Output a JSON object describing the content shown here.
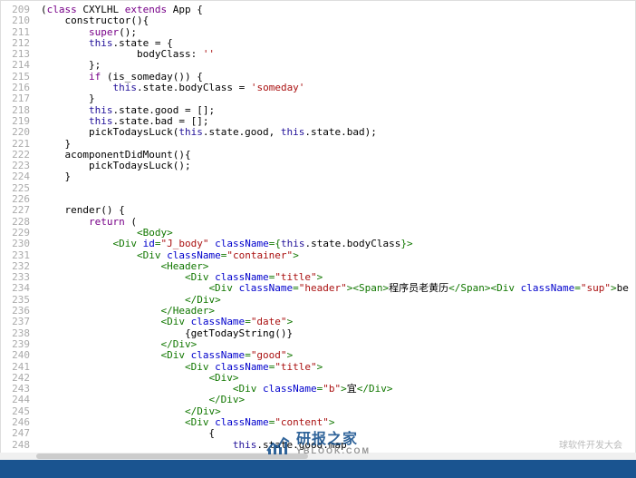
{
  "lines": [
    {
      "n": 209,
      "t": [
        [
          "",
          "("
        ],
        [
          "kw",
          "class"
        ],
        [
          "",
          " CXYLHL "
        ],
        [
          "kw",
          "extends"
        ],
        [
          "",
          " App {"
        ]
      ]
    },
    {
      "n": 210,
      "t": [
        [
          "",
          "    constructor(){"
        ]
      ]
    },
    {
      "n": 211,
      "t": [
        [
          "",
          "        "
        ],
        [
          "kw",
          "super"
        ],
        [
          "",
          "();"
        ]
      ]
    },
    {
      "n": 212,
      "t": [
        [
          "",
          "        "
        ],
        [
          "this",
          "this"
        ],
        [
          "",
          ".state = {"
        ]
      ]
    },
    {
      "n": 213,
      "t": [
        [
          "",
          "                bodyClass: "
        ],
        [
          "str",
          "''"
        ]
      ]
    },
    {
      "n": 214,
      "t": [
        [
          "",
          "        };"
        ]
      ]
    },
    {
      "n": 215,
      "t": [
        [
          "",
          "        "
        ],
        [
          "kw",
          "if"
        ],
        [
          "",
          " (is_someday()) {"
        ]
      ]
    },
    {
      "n": 216,
      "t": [
        [
          "",
          "            "
        ],
        [
          "this",
          "this"
        ],
        [
          "",
          ".state.bodyClass = "
        ],
        [
          "str",
          "'someday'"
        ]
      ]
    },
    {
      "n": 217,
      "t": [
        [
          "",
          "        }"
        ]
      ]
    },
    {
      "n": 218,
      "t": [
        [
          "",
          "        "
        ],
        [
          "this",
          "this"
        ],
        [
          "",
          ".state.good = [];"
        ]
      ]
    },
    {
      "n": 219,
      "t": [
        [
          "",
          "        "
        ],
        [
          "this",
          "this"
        ],
        [
          "",
          ".state.bad = [];"
        ]
      ]
    },
    {
      "n": 220,
      "t": [
        [
          "",
          "        pickTodaysLuck("
        ],
        [
          "this",
          "this"
        ],
        [
          "",
          ".state.good, "
        ],
        [
          "this",
          "this"
        ],
        [
          "",
          ".state.bad);"
        ]
      ]
    },
    {
      "n": 221,
      "t": [
        [
          "",
          "    }"
        ]
      ]
    },
    {
      "n": 222,
      "t": [
        [
          "",
          "    acomponentDidMount(){"
        ]
      ]
    },
    {
      "n": 223,
      "t": [
        [
          "",
          "        pickTodaysLuck();"
        ]
      ]
    },
    {
      "n": 224,
      "t": [
        [
          "",
          "    }"
        ]
      ]
    },
    {
      "n": 225,
      "t": [
        [
          "",
          ""
        ]
      ]
    },
    {
      "n": 226,
      "t": [
        [
          "",
          ""
        ]
      ]
    },
    {
      "n": 227,
      "t": [
        [
          "",
          "    render() {"
        ]
      ]
    },
    {
      "n": 228,
      "t": [
        [
          "",
          "        "
        ],
        [
          "kw",
          "return"
        ],
        [
          "",
          " ("
        ]
      ]
    },
    {
      "n": 229,
      "t": [
        [
          "",
          "                "
        ],
        [
          "tag",
          "<Body>"
        ]
      ]
    },
    {
      "n": 230,
      "t": [
        [
          "",
          "            "
        ],
        [
          "tag",
          "<Div "
        ],
        [
          "attr",
          "id"
        ],
        [
          "tag",
          "="
        ],
        [
          "str",
          "\"J_body\""
        ],
        [
          "tag",
          " "
        ],
        [
          "attr",
          "className"
        ],
        [
          "tag",
          "={"
        ],
        [
          "this",
          "this"
        ],
        [
          "",
          ".state.bodyClass"
        ],
        [
          "tag",
          "}>"
        ]
      ]
    },
    {
      "n": 231,
      "t": [
        [
          "",
          "                "
        ],
        [
          "tag",
          "<Div "
        ],
        [
          "attr",
          "className"
        ],
        [
          "tag",
          "="
        ],
        [
          "str",
          "\"container\""
        ],
        [
          "tag",
          ">"
        ]
      ]
    },
    {
      "n": 232,
      "t": [
        [
          "",
          "                    "
        ],
        [
          "tag",
          "<Header>"
        ]
      ]
    },
    {
      "n": 233,
      "t": [
        [
          "",
          "                        "
        ],
        [
          "tag",
          "<Div "
        ],
        [
          "attr",
          "className"
        ],
        [
          "tag",
          "="
        ],
        [
          "str",
          "\"title\""
        ],
        [
          "tag",
          ">"
        ]
      ]
    },
    {
      "n": 234,
      "t": [
        [
          "",
          "                            "
        ],
        [
          "tag",
          "<Div "
        ],
        [
          "attr",
          "className"
        ],
        [
          "tag",
          "="
        ],
        [
          "str",
          "\"header\""
        ],
        [
          "tag",
          "><Span>"
        ],
        [
          "",
          "程序员老黄历"
        ],
        [
          "tag",
          "</Span><Div "
        ],
        [
          "attr",
          "className"
        ],
        [
          "tag",
          "="
        ],
        [
          "str",
          "\"sup\""
        ],
        [
          "tag",
          ">"
        ],
        [
          "",
          "be"
        ]
      ]
    },
    {
      "n": 235,
      "t": [
        [
          "",
          "                        "
        ],
        [
          "tag",
          "</Div>"
        ]
      ]
    },
    {
      "n": 236,
      "t": [
        [
          "",
          "                    "
        ],
        [
          "tag",
          "</Header>"
        ]
      ]
    },
    {
      "n": 237,
      "t": [
        [
          "",
          "                    "
        ],
        [
          "tag",
          "<Div "
        ],
        [
          "attr",
          "className"
        ],
        [
          "tag",
          "="
        ],
        [
          "str",
          "\"date\""
        ],
        [
          "tag",
          ">"
        ]
      ]
    },
    {
      "n": 238,
      "t": [
        [
          "",
          "                        {getTodayString()}"
        ]
      ]
    },
    {
      "n": 239,
      "t": [
        [
          "",
          "                    "
        ],
        [
          "tag",
          "</Div>"
        ]
      ]
    },
    {
      "n": 240,
      "t": [
        [
          "",
          "                    "
        ],
        [
          "tag",
          "<Div "
        ],
        [
          "attr",
          "className"
        ],
        [
          "tag",
          "="
        ],
        [
          "str",
          "\"good\""
        ],
        [
          "tag",
          ">"
        ]
      ]
    },
    {
      "n": 241,
      "t": [
        [
          "",
          "                        "
        ],
        [
          "tag",
          "<Div "
        ],
        [
          "attr",
          "className"
        ],
        [
          "tag",
          "="
        ],
        [
          "str",
          "\"title\""
        ],
        [
          "tag",
          ">"
        ]
      ]
    },
    {
      "n": 242,
      "t": [
        [
          "",
          "                            "
        ],
        [
          "tag",
          "<Div>"
        ]
      ]
    },
    {
      "n": 243,
      "t": [
        [
          "",
          "                                "
        ],
        [
          "tag",
          "<Div "
        ],
        [
          "attr",
          "className"
        ],
        [
          "tag",
          "="
        ],
        [
          "str",
          "\"b\""
        ],
        [
          "tag",
          ">"
        ],
        [
          "",
          "宜"
        ],
        [
          "tag",
          "</Div>"
        ]
      ]
    },
    {
      "n": 244,
      "t": [
        [
          "",
          "                            "
        ],
        [
          "tag",
          "</Div>"
        ]
      ]
    },
    {
      "n": 245,
      "t": [
        [
          "",
          "                        "
        ],
        [
          "tag",
          "</Div>"
        ]
      ]
    },
    {
      "n": 246,
      "t": [
        [
          "",
          "                        "
        ],
        [
          "tag",
          "<Div "
        ],
        [
          "attr",
          "className"
        ],
        [
          "tag",
          "="
        ],
        [
          "str",
          "\"content\""
        ],
        [
          "tag",
          ">"
        ]
      ]
    },
    {
      "n": 247,
      "t": [
        [
          "",
          "                            {"
        ]
      ]
    },
    {
      "n": 248,
      "t": [
        [
          "",
          "                                "
        ],
        [
          "this",
          "this"
        ],
        [
          "",
          ".state.good.map"
        ]
      ]
    }
  ],
  "watermark": {
    "main": "研报之家",
    "sub": "YBLOOK.COM"
  },
  "bottomText": "球软件开发大会"
}
